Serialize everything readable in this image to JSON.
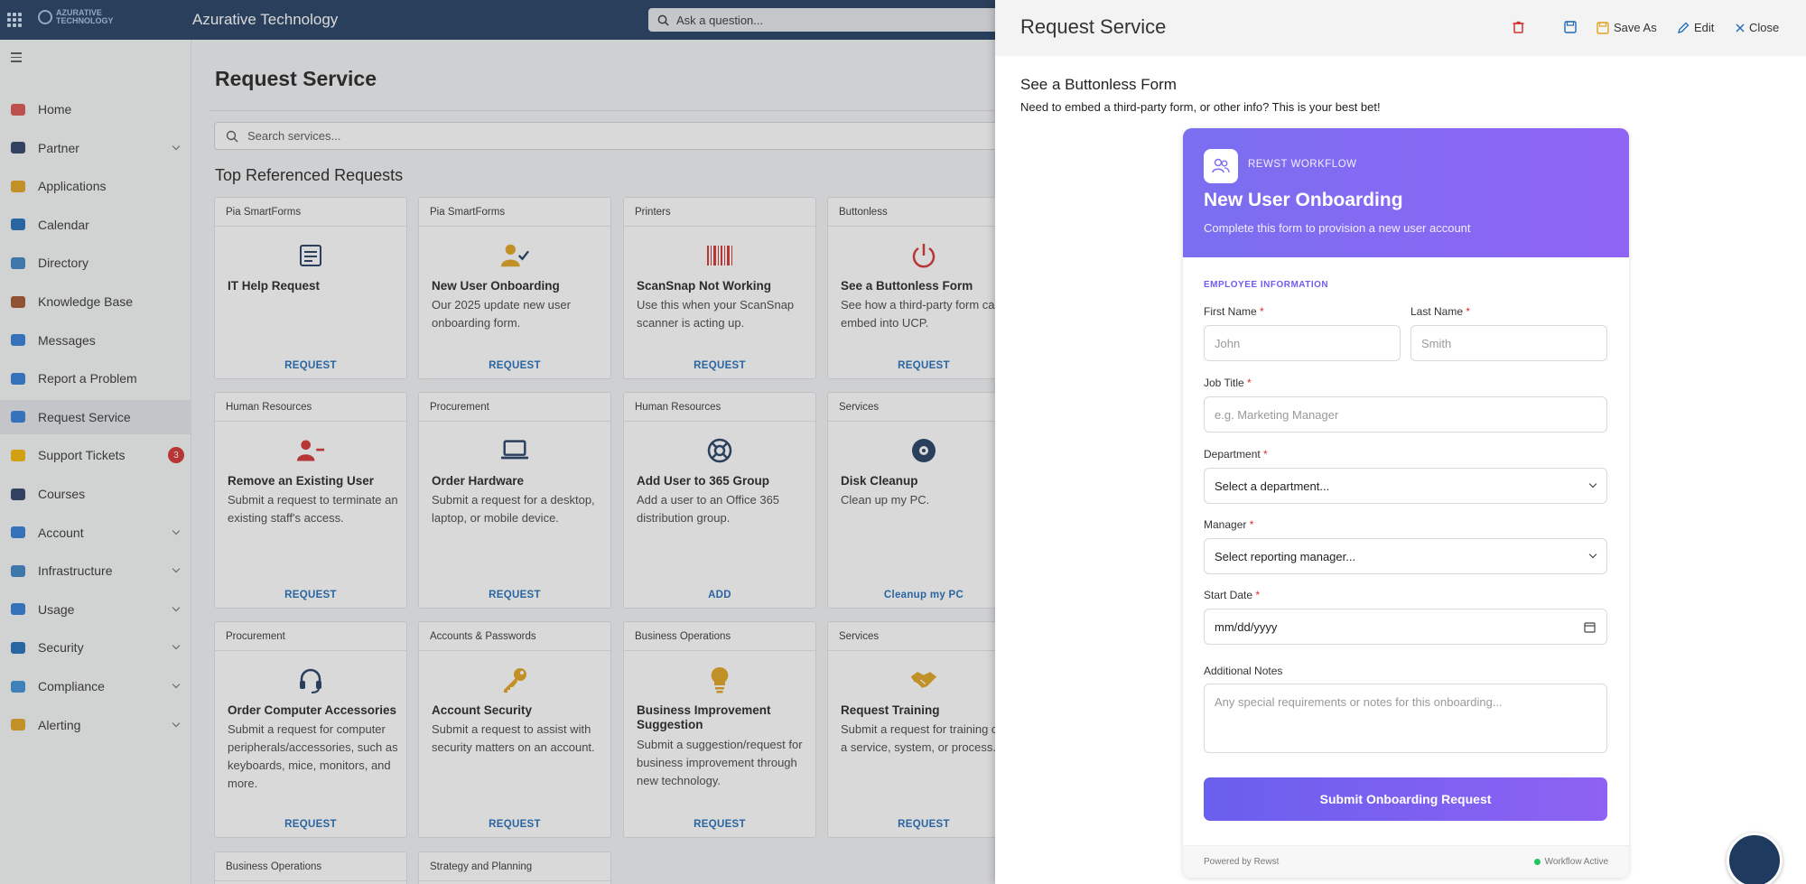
{
  "app": {
    "title": "Azurative Technology",
    "logo_text": "AZURATIVE TECHNOLOGY",
    "ask_placeholder": "Ask a question..."
  },
  "sidebar": {
    "items": [
      {
        "label": "Home",
        "icon": "home-icon"
      },
      {
        "label": "Partner",
        "icon": "partner-icon",
        "expandable": true
      },
      {
        "label": "Applications",
        "icon": "applications-icon"
      },
      {
        "label": "Calendar",
        "icon": "calendar-icon"
      },
      {
        "label": "Directory",
        "icon": "directory-icon"
      },
      {
        "label": "Knowledge Base",
        "icon": "book-icon"
      },
      {
        "label": "Messages",
        "icon": "mail-icon"
      },
      {
        "label": "Report a Problem",
        "icon": "report-icon"
      },
      {
        "label": "Request Service",
        "icon": "request-icon",
        "active": true
      },
      {
        "label": "Support Tickets",
        "icon": "ticket-icon",
        "badge": "3"
      },
      {
        "label": "Courses",
        "icon": "courses-icon"
      },
      {
        "label": "Account",
        "icon": "account-icon",
        "expandable": true
      },
      {
        "label": "Infrastructure",
        "icon": "infrastructure-icon",
        "expandable": true
      },
      {
        "label": "Usage",
        "icon": "usage-icon",
        "expandable": true
      },
      {
        "label": "Security",
        "icon": "shield-icon",
        "expandable": true
      },
      {
        "label": "Compliance",
        "icon": "compliance-icon",
        "expandable": true
      },
      {
        "label": "Alerting",
        "icon": "alert-icon",
        "expandable": true
      }
    ]
  },
  "main": {
    "title": "Request Service",
    "search_placeholder": "Search services...",
    "section_title": "Top Referenced Requests",
    "cards": [
      {
        "category": "Pia SmartForms",
        "title": "IT Help Request",
        "desc": "",
        "action": "REQUEST",
        "icon": "form-icon"
      },
      {
        "category": "Pia SmartForms",
        "title": "New User Onboarding",
        "desc": "Our 2025 update new user onboarding form.",
        "action": "REQUEST",
        "icon": "user-check-icon"
      },
      {
        "category": "Printers",
        "title": "ScanSnap Not Working",
        "desc": "Use this when your ScanSnap scanner is acting up.",
        "action": "REQUEST",
        "icon": "barcode-icon"
      },
      {
        "category": "Buttonless",
        "title": "See a Buttonless Form",
        "desc": "See how a third-party form ca embed into UCP.",
        "action": "REQUEST",
        "icon": "power-icon"
      },
      {
        "category": "Human Resources",
        "title": "Remove an Existing User",
        "desc": "Submit a request to terminate an existing staff's access.",
        "action": "REQUEST",
        "icon": "user-minus-icon"
      },
      {
        "category": "Procurement",
        "title": "Order Hardware",
        "desc": "Submit a request for a desktop, laptop, or mobile device.",
        "action": "REQUEST",
        "icon": "laptop-icon"
      },
      {
        "category": "Human Resources",
        "title": "Add User to 365 Group",
        "desc": "Add a user to an Office 365 distribution group.",
        "action": "ADD",
        "icon": "lifebuoy-icon"
      },
      {
        "category": "Services",
        "title": "Disk Cleanup",
        "desc": "Clean up my PC.",
        "action": "Cleanup my PC",
        "icon": "disk-icon"
      },
      {
        "category": "Procurement",
        "title": "Order Computer Accessories",
        "desc": "Submit a request for computer peripherals/accessories, such as keyboards, mice, monitors, and more.",
        "action": "REQUEST",
        "icon": "headset-icon"
      },
      {
        "category": "Accounts & Passwords",
        "title": "Account Security",
        "desc": "Submit a request to assist with security matters on an account.",
        "action": "REQUEST",
        "icon": "key-icon"
      },
      {
        "category": "Business Operations",
        "title": "Business Improvement Suggestion",
        "desc": "Submit a suggestion/request for business improvement through new technology.",
        "action": "REQUEST",
        "icon": "lightbulb-icon"
      },
      {
        "category": "Services",
        "title": "Request Training",
        "desc": "Submit a request for training on a service, system, or process.",
        "action": "REQUEST",
        "icon": "handshake-icon"
      },
      {
        "category": "Business Operations",
        "title": "",
        "desc": "",
        "action": "",
        "icon": ""
      },
      {
        "category": "Strategy and Planning",
        "title": "",
        "desc": "",
        "action": "",
        "icon": ""
      }
    ]
  },
  "panel": {
    "title": "Request Service",
    "toolbar": {
      "save_as": "Save As",
      "edit": "Edit",
      "close": "Close"
    },
    "form_heading": "See a Buttonless Form",
    "form_subheading": "Need to embed a third-party form, or other info? This is your best bet!",
    "form": {
      "tag": "REWST WORKFLOW",
      "title": "New User Onboarding",
      "subtitle": "Complete this form to provision a new user account",
      "section": "EMPLOYEE INFORMATION",
      "first_name_label": "First Name",
      "first_name_placeholder": "John",
      "last_name_label": "Last Name",
      "last_name_placeholder": "Smith",
      "job_title_label": "Job Title",
      "job_title_placeholder": "e.g. Marketing Manager",
      "department_label": "Department",
      "department_value": "Select a department...",
      "manager_label": "Manager",
      "manager_value": "Select reporting manager...",
      "start_date_label": "Start Date",
      "start_date_value": "mm/dd/yyyy",
      "notes_label": "Additional Notes",
      "notes_placeholder": "Any special requirements or notes for this onboarding...",
      "submit": "Submit Onboarding Request",
      "footer_left": "Powered by Rewst",
      "footer_right": "Workflow Active"
    }
  },
  "colors": {
    "topbar": "#1e3a5f",
    "accent": "#7a6ff0",
    "link": "#1e6bb8",
    "danger": "#d32f2f"
  }
}
